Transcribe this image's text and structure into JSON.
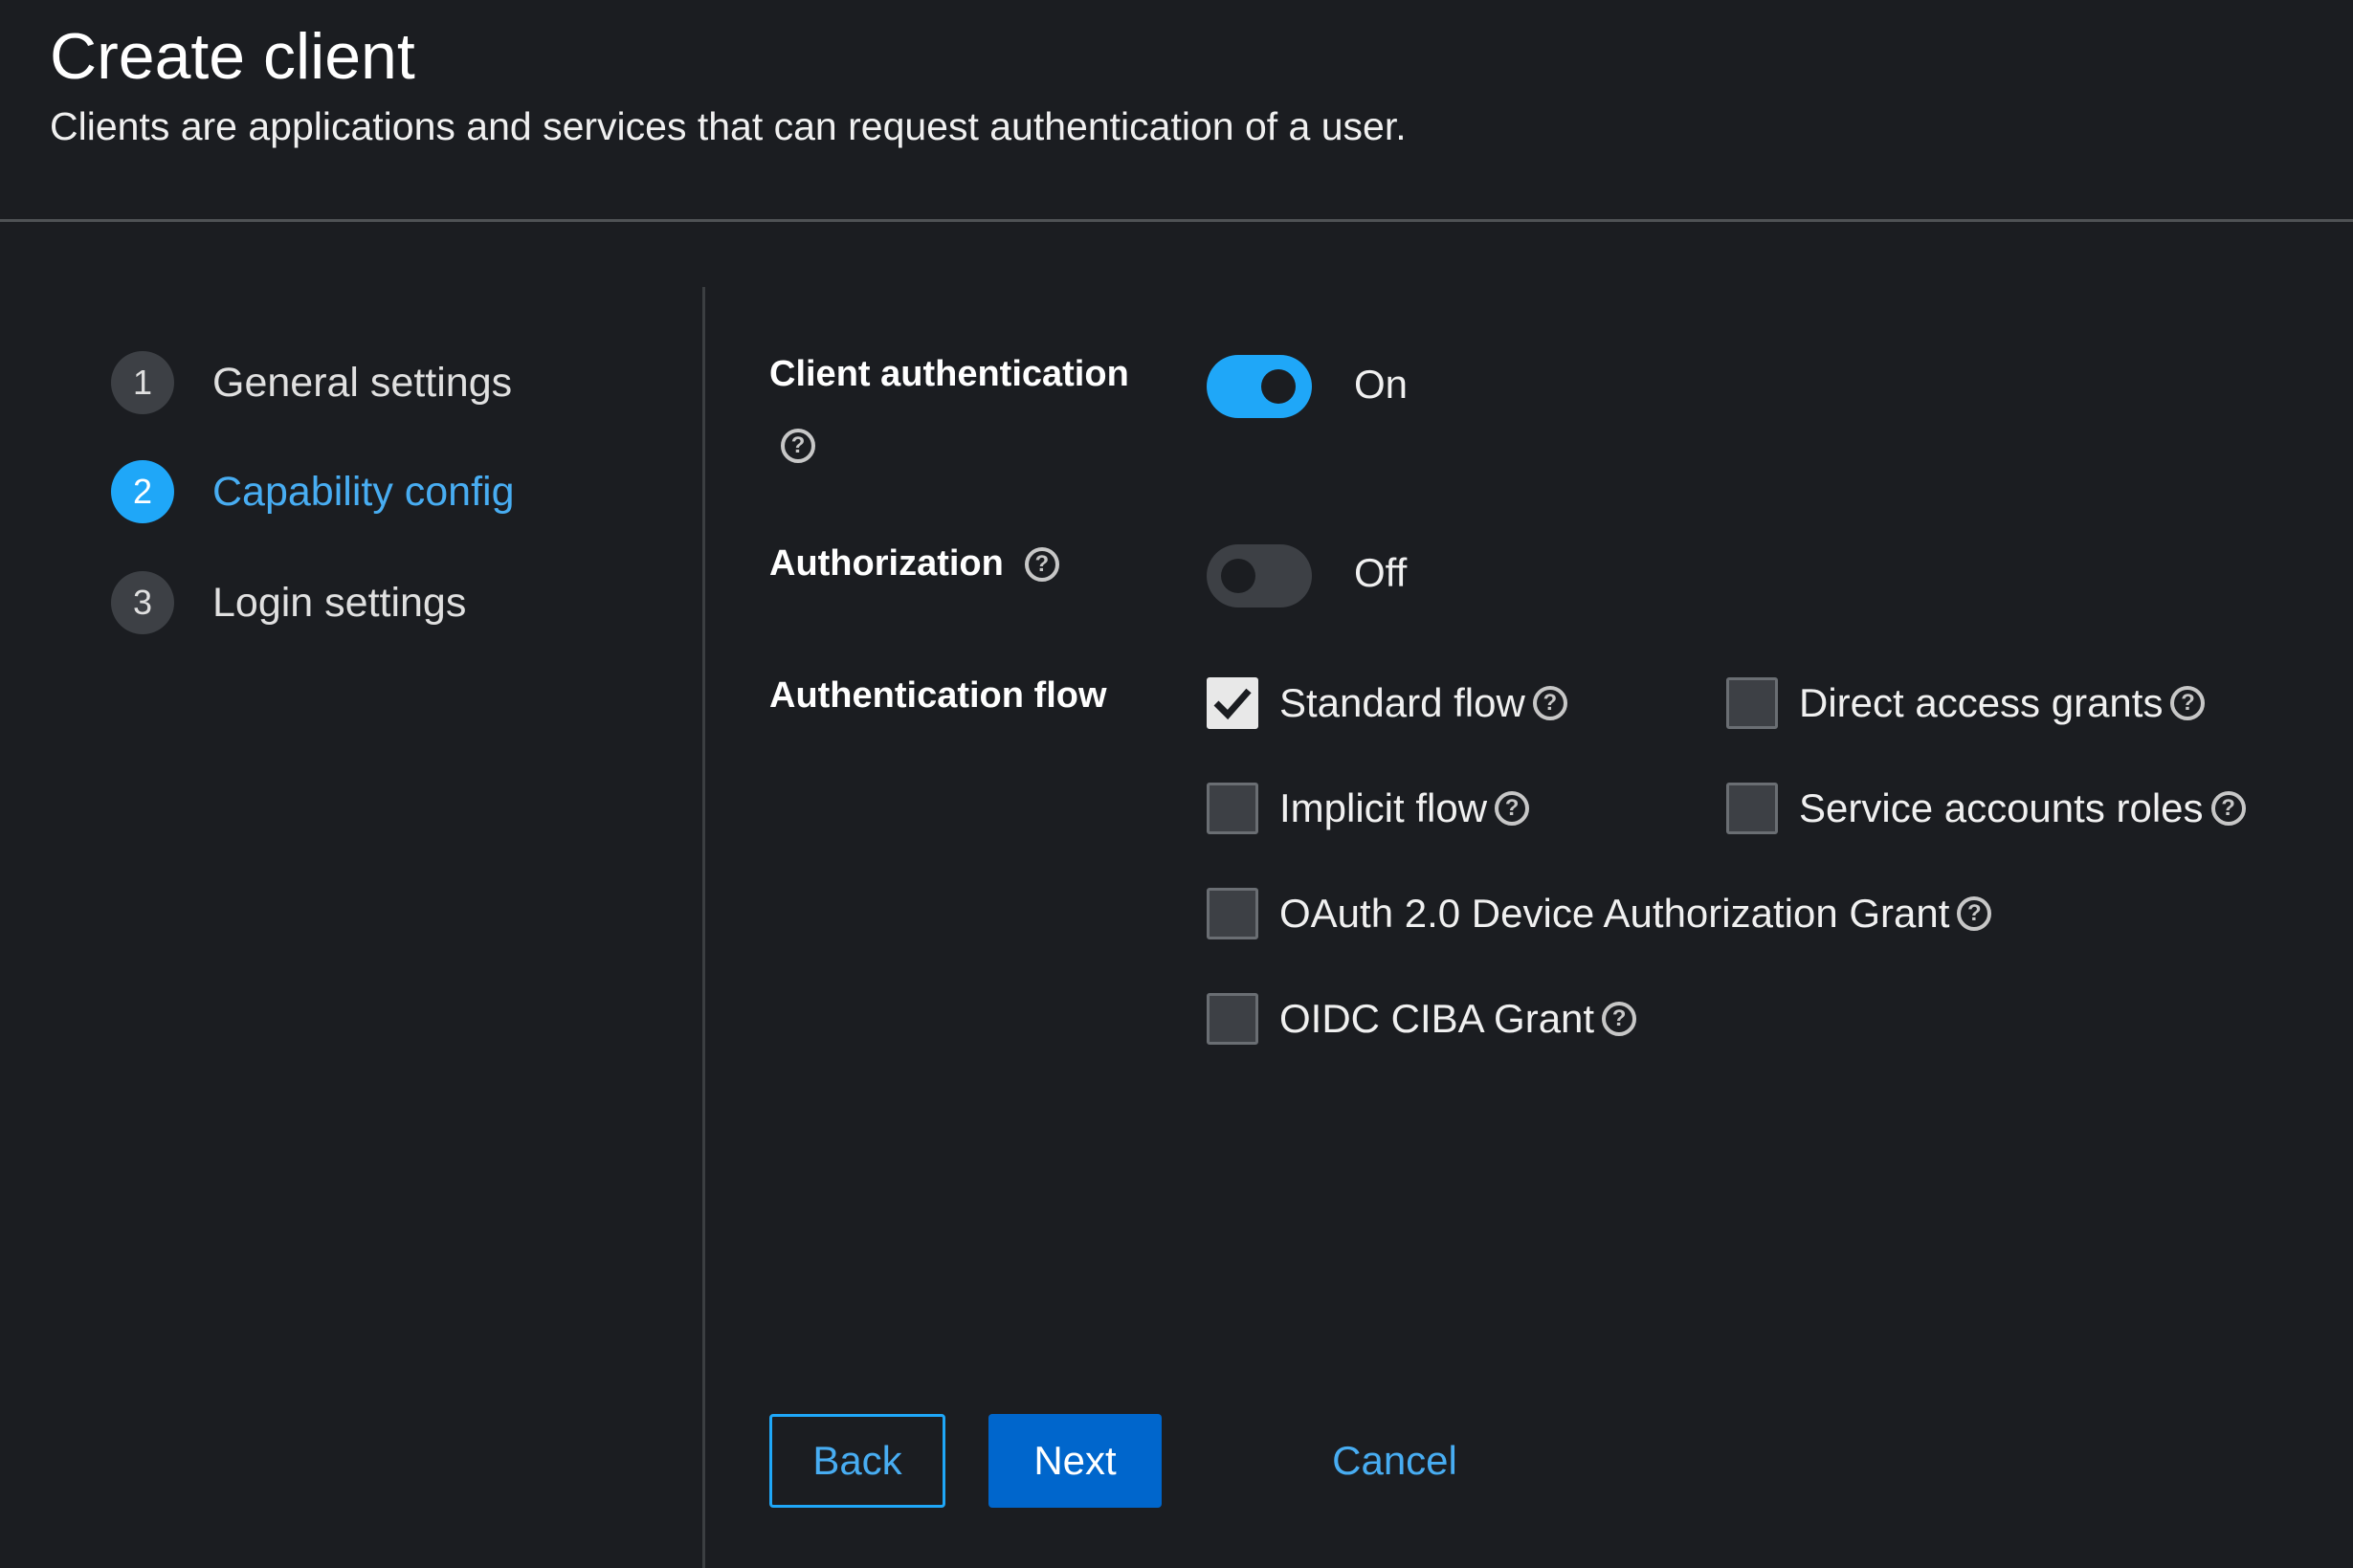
{
  "header": {
    "title": "Create client",
    "subtitle": "Clients are applications and services that can request authentication of a user."
  },
  "steps": [
    {
      "number": "1",
      "label": "General settings",
      "active": false
    },
    {
      "number": "2",
      "label": "Capability config",
      "active": true
    },
    {
      "number": "3",
      "label": "Login settings",
      "active": false
    }
  ],
  "form": {
    "client_authentication": {
      "label": "Client authentication",
      "state": "On",
      "enabled": true
    },
    "authorization": {
      "label": "Authorization",
      "state": "Off",
      "enabled": false
    },
    "authentication_flow": {
      "label": "Authentication flow",
      "options": {
        "standard_flow": {
          "label": "Standard flow",
          "checked": true
        },
        "direct_access_grants": {
          "label": "Direct access grants",
          "checked": false
        },
        "implicit_flow": {
          "label": "Implicit flow",
          "checked": false
        },
        "service_accounts_roles": {
          "label": "Service accounts roles",
          "checked": false
        },
        "oauth_device_grant": {
          "label": "OAuth 2.0 Device Authorization Grant",
          "checked": false
        },
        "oidc_ciba_grant": {
          "label": "OIDC CIBA Grant",
          "checked": false
        }
      }
    }
  },
  "help_glyph": "?",
  "buttons": {
    "back": "Back",
    "next": "Next",
    "cancel": "Cancel"
  },
  "colors": {
    "background": "#1b1d21",
    "accent": "#1fa7f8",
    "primary_button": "#0066cc",
    "link": "#48adf2"
  }
}
